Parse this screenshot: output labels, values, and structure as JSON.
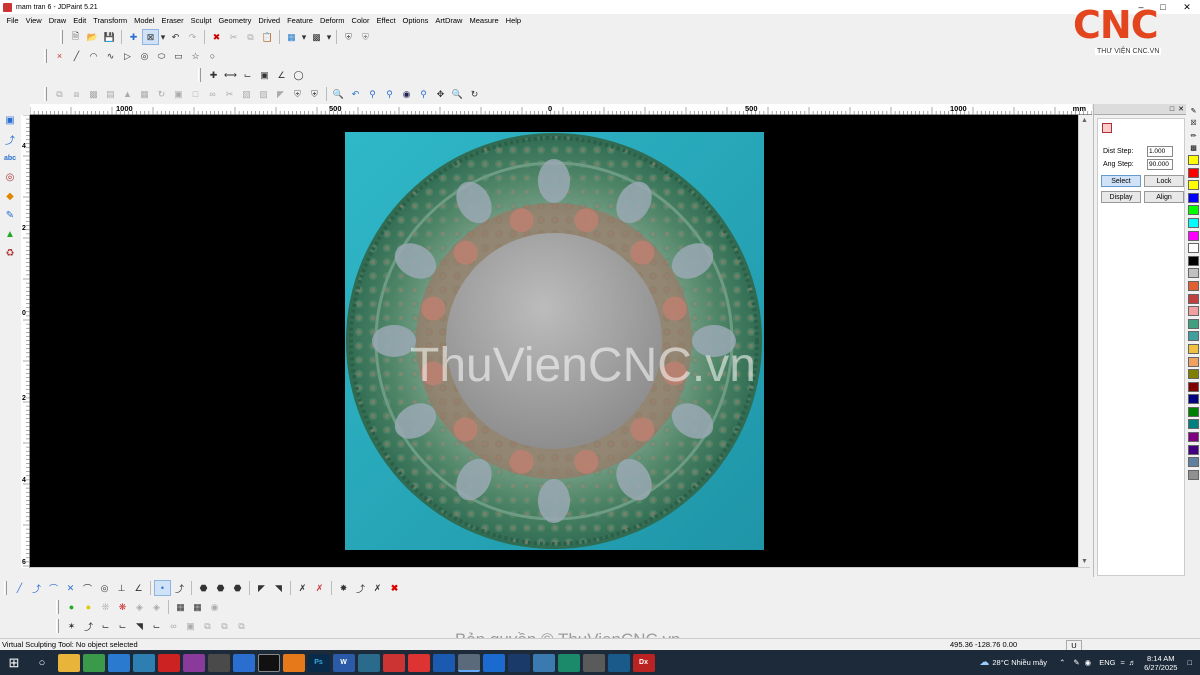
{
  "window": {
    "title": "mam tran 6 - JDPaint 5.21"
  },
  "menu": [
    "File",
    "View",
    "Draw",
    "Edit",
    "Transform",
    "Model",
    "Eraser",
    "Sculpt",
    "Geometry",
    "Drived",
    "Feature",
    "Deform",
    "Color",
    "Effect",
    "Options",
    "ArtDraw",
    "Measure",
    "Help"
  ],
  "ruler": {
    "top_labels": [
      "1000",
      "500",
      "0",
      "500",
      "1000"
    ],
    "unit": "mm",
    "left_labels": [
      "4",
      "2",
      "0",
      "2",
      "4",
      "6"
    ]
  },
  "panel": {
    "dist_step_label": "Dist Step:",
    "dist_step_value": "1.000",
    "ang_step_label": "Ang Step:",
    "ang_step_value": "90.000",
    "select_label": "Select",
    "lock_label": "Lock",
    "display_label": "Display",
    "align_label": "Align"
  },
  "palette_colors": [
    "#ffff00",
    "#ff0000",
    "#ffff00",
    "#0000ff",
    "#00ff00",
    "#00ffff",
    "#ff00ff",
    "#ffffff",
    "#000000",
    "#c0c0c0",
    "#e06030",
    "#c04040",
    "#f0a0a0",
    "#40a080",
    "#40a0a0",
    "#f0c040",
    "#f0a060",
    "#808000",
    "#800000",
    "#000080",
    "#008000",
    "#008080",
    "#800080",
    "#400080",
    "#6080a0",
    "#909090"
  ],
  "status": {
    "message": "Virtual Sculpting Tool: No object selected",
    "coords": "495.36 -128.76 0.00",
    "unit": "U"
  },
  "taskbar": {
    "weather": "28°C  Nhiều mây",
    "lang": "ENG",
    "time": "8:14 AM",
    "date": "6/27/2025",
    "apps": [
      "folder",
      "chrome",
      "edge",
      "store",
      "search",
      "winrar",
      "app",
      "app",
      "teamviewer",
      "blender",
      "Ps",
      "W",
      "calc",
      "app",
      "opera",
      "shield",
      "jdpaint",
      "app",
      "app",
      "app",
      "app",
      "app",
      "app",
      "Dx"
    ]
  },
  "branding": {
    "logo_text": "CNC",
    "logo_sub": "THƯ VIỆN CNC.VN",
    "watermark": "ThuVienCNC.vn",
    "copyright": "Bản quyền © ThuVienCNC.vn"
  }
}
